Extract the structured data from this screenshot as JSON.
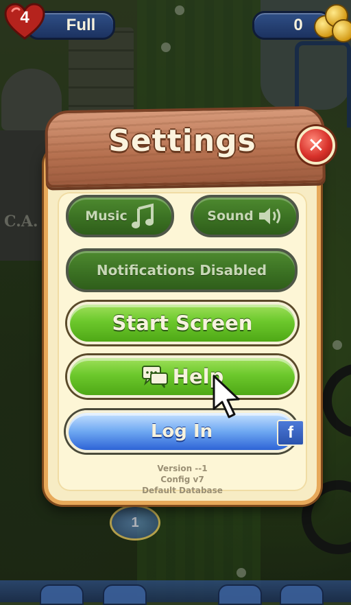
{
  "hud": {
    "lives_count": "4",
    "lives_status": "Full",
    "coins": "0"
  },
  "settings": {
    "title": "Settings",
    "close_symbol": "✕",
    "music_label": "Music",
    "sound_label": "Sound",
    "notifications_label": "Notifications Disabled",
    "start_screen_label": "Start Screen",
    "help_label": "Help",
    "login_label": "Log In",
    "facebook_glyph": "f",
    "version": "Version --1",
    "config": "Config v7",
    "database": "Default Database"
  },
  "map": {
    "level_marker": "1"
  },
  "colors": {
    "green_button": "#6cc82c",
    "dark_green_button": "#3b7123",
    "blue_button": "#6ea8f2",
    "close_red": "#d8312a",
    "panel_cream": "#fdf6d6",
    "wood_banner": "#b5704f"
  },
  "icons": {
    "music": "music-note-icon",
    "sound": "speaker-icon",
    "help": "chat-bubble-icon",
    "close": "close-icon",
    "facebook": "facebook-icon",
    "lives": "heart-icon",
    "coins": "coin-stack-icon",
    "pointer": "mouse-cursor-icon"
  }
}
